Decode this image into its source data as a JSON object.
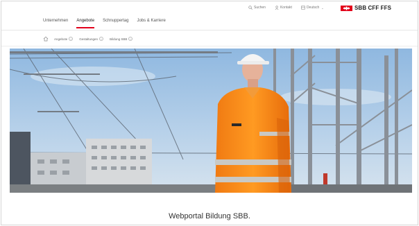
{
  "utility": {
    "items": [
      {
        "label": "Suchen",
        "icon": "search-icon"
      },
      {
        "label": "Kontakt",
        "icon": "user-icon"
      },
      {
        "label": "Deutsch",
        "icon": "language-icon"
      }
    ]
  },
  "brand": {
    "wordmark": "SBB CFF FFS",
    "color": "#e2001a"
  },
  "nav": {
    "items": [
      {
        "label": "Unternehmen",
        "active": false
      },
      {
        "label": "Angebote",
        "active": true
      },
      {
        "label": "Schnuppertag",
        "active": false
      },
      {
        "label": "Jobs & Karriere",
        "active": false
      }
    ]
  },
  "subnav": {
    "items": [
      "Angebote",
      "Gestaltungen",
      "Bildung SBB"
    ]
  },
  "hero": {
    "alt": "Worker in high-visibility orange vest and white helmet at railway station"
  },
  "page": {
    "heading": "Webportal Bildung SBB."
  }
}
